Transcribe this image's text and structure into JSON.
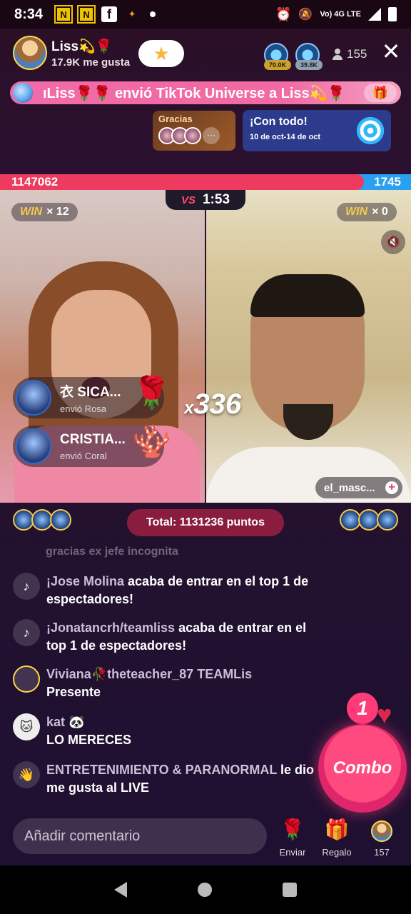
{
  "status_bar": {
    "time": "8:34",
    "network": "Vo) 4G\nLTE"
  },
  "host": {
    "name": "Liss💫🌹",
    "likes": "17.9K me gusta"
  },
  "top_viewers": [
    {
      "badge": "70.0K"
    },
    {
      "badge": "39.8K"
    }
  ],
  "viewer_count": "155",
  "gift_banner": {
    "text": "ıLiss🌹🌹 envió TikTok Universe a Liss💫🌹"
  },
  "thanks_card": {
    "title": "Gracias"
  },
  "event_card": {
    "title": "¡Con todo!",
    "dates": "10 de oct-14 de oct"
  },
  "battle": {
    "left_score": "1147062",
    "right_score": "1745",
    "left_win_count": "× 12",
    "right_win_count": "× 0",
    "win_label": "WIN",
    "timer": "1:53",
    "vs_label": "VS"
  },
  "gift_feed": [
    {
      "name": "衣 SICA...",
      "sub": "envió Rosa",
      "gift_icon": "🌹"
    },
    {
      "name": "CRISTIA...",
      "sub": "envió Coral",
      "gift_icon": "🪸"
    }
  ],
  "combo_overlay": {
    "prefix": "x",
    "count": "336"
  },
  "opponent_tag": "el_masc...",
  "total_points": "Total: 1131236 puntos",
  "chat": {
    "faded_line": "gracias  ex  jefe  incognita",
    "messages": [
      {
        "icon": "tiktok-icon",
        "name": "¡Jose Molina",
        "text": " acaba de entrar en el top 1 de espectadores!"
      },
      {
        "icon": "tiktok-icon",
        "name": "¡Jonatancrh/teamliss",
        "text": " acaba de entrar en el top 1 de espectadores!"
      },
      {
        "icon": "avatar",
        "name": "Viviana🥀theteacher_87 TEAMLis",
        "text": "Presente"
      },
      {
        "icon": "avatar",
        "name": "kat 🐼",
        "text": "LO MERECES"
      },
      {
        "icon": "wave-icon",
        "name": "ENTRETENIMIENTO & PARANORMAL",
        "text": " le dio me gusta al LIVE"
      }
    ]
  },
  "combo_button": {
    "label": "Combo",
    "count": "1"
  },
  "bottom_bar": {
    "comment_placeholder": "Añadir comentario",
    "send_label": "Enviar",
    "gift_label": "Regalo",
    "viewers_label": "157"
  }
}
